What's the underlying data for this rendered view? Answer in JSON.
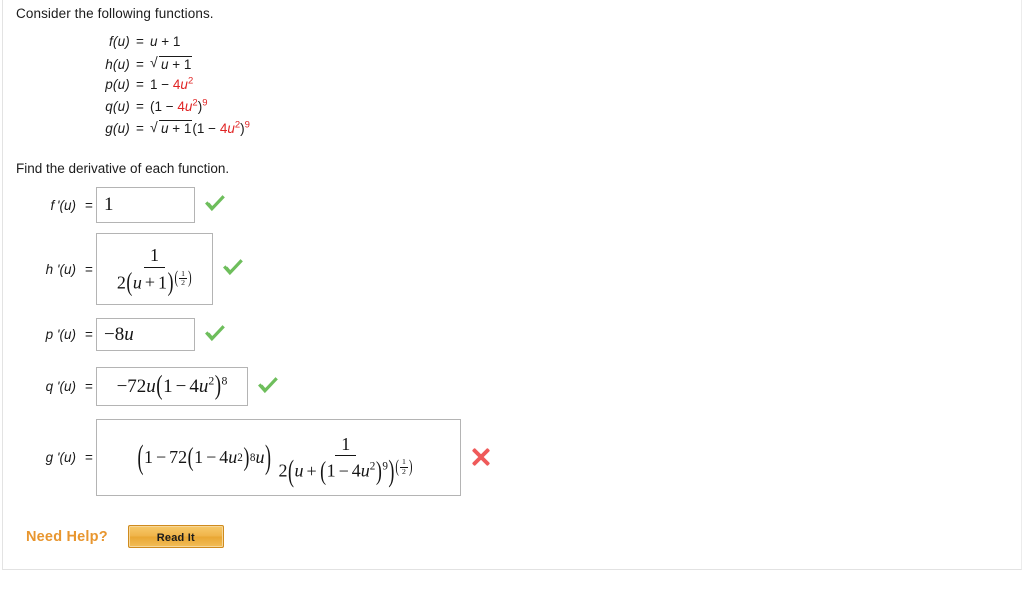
{
  "intro": "Consider the following functions.",
  "prompt": "Find the derivative of each function.",
  "functions": [
    {
      "name": "f(u)",
      "eq": "=",
      "id": "f"
    },
    {
      "name": "h(u)",
      "eq": "=",
      "id": "h"
    },
    {
      "name": "p(u)",
      "eq": "=",
      "id": "p"
    },
    {
      "name": "q(u)",
      "eq": "=",
      "id": "q"
    },
    {
      "name": "g(u)",
      "eq": "=",
      "id": "g"
    }
  ],
  "function_bodies": {
    "f": "u + 1",
    "h": "√(u + 1)",
    "p": "1 − 4u²",
    "q": "(1 − 4u²)⁹",
    "g": "√(u + 1)(1 − 4u²)⁹"
  },
  "answers": [
    {
      "label": "f '(u)",
      "eq": "=",
      "value": "1",
      "status": "correct",
      "status_icon": "green-check-icon"
    },
    {
      "label": "h '(u)",
      "eq": "=",
      "value": "1 / (2(u + 1)^(1/2))",
      "status": "correct",
      "status_icon": "green-check-icon"
    },
    {
      "label": "p '(u)",
      "eq": "=",
      "value": "−8u",
      "status": "correct",
      "status_icon": "green-check-icon"
    },
    {
      "label": "q '(u)",
      "eq": "=",
      "value": "−72u(1 − 4u²)⁸",
      "status": "correct",
      "status_icon": "green-check-icon"
    },
    {
      "label": "g '(u)",
      "eq": "=",
      "value": "(1 − 72(1 − 4u²)⁸u) · 1 / (2(u + (1 − 4u²)⁹)^(1/2))",
      "status": "incorrect",
      "status_icon": "red-x-icon"
    }
  ],
  "math_tokens": {
    "one": "1",
    "two": "2",
    "eight": "8",
    "nine": "9",
    "four": "4",
    "seventytwo": "72",
    "u": "u",
    "minus": "−",
    "plus": "+",
    "neg8u_num": "8",
    "lparen": "(",
    "rparen": ")"
  },
  "need_help": {
    "label": "Need Help?",
    "button_label": "Read It"
  },
  "colors": {
    "highlight_red": "#e02424",
    "correct_green": "#6ebe5c",
    "incorrect_red": "#ef5a5a",
    "help_orange": "#e8962f",
    "box_border": "#b4b4b4"
  }
}
